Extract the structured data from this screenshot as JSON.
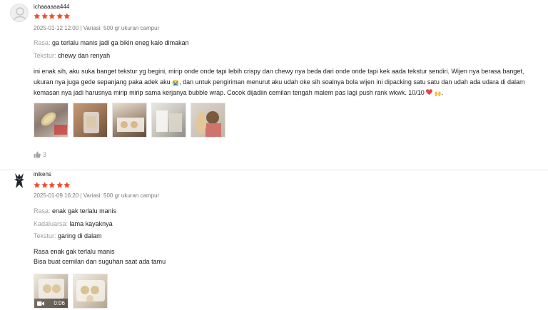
{
  "reviews": [
    {
      "username": "ichaaaaaa444",
      "rating": 5,
      "meta": "2025-01-12 12:00 | Variasi: 500 gr ukuran campur",
      "attributes": [
        {
          "label": "Rasa:",
          "value": "ga terlalu manis jadi ga bikin eneg kalo dimakan"
        },
        {
          "label": "Tekstur:",
          "value": "chewy dan renyah"
        }
      ],
      "body": {
        "p1": "ini enak sih, aku suka banget tekstur yg begini, mirip onde onde tapi lebih crispy dan chewy nya beda dari onde onde tapi kek aada tekstur sendiri. Wijen nya berasa banget, ukuran nya juga gede sepanjang paka adek aku",
        "emoji1": "😭",
        "p2": ", dan untuk pengiriman menurut aku udah oke sih soalnya bola wijen ini dipacking satu satu dan udah ada udara di dalam kemasan nya jadi harusnya mirip mirip sama kerjanya bubble wrap. Cocok dijadiin cemilan tengah malem pas lagi push rank wkwk. 10/10",
        "emoji3": "🙌",
        "end": "."
      },
      "likes": "3"
    },
    {
      "username": "inikens",
      "rating": 5,
      "meta": "2025-01-09 16:20 | Variasi: 500 gr ukuran campur",
      "attributes": [
        {
          "label": "Rasa:",
          "value": "enak gak terlalu manis"
        },
        {
          "label": "Kadaluarsa:",
          "value": "lama kayaknya"
        },
        {
          "label": "Tekstur:",
          "value": "garing di dalam"
        }
      ],
      "body_lines": [
        "Rasa enak gak terlalu manis",
        "Bisa buat cemilan dan suguhan saat ada tamu"
      ],
      "video_duration": "0:06"
    }
  ],
  "colors": {
    "star": "#ee4d2d",
    "heart": "#e8434b"
  }
}
